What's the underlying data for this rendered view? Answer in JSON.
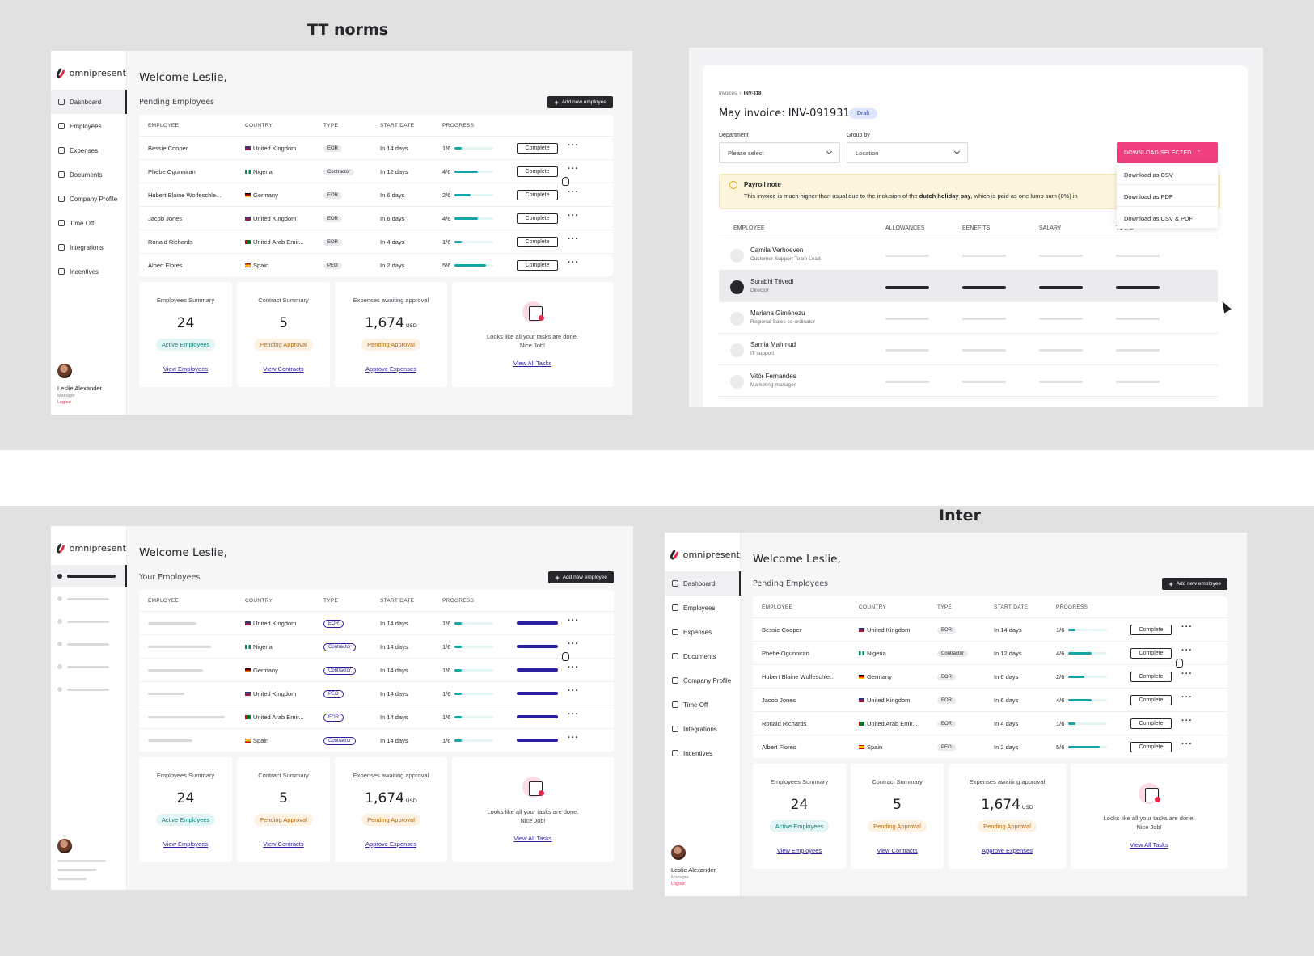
{
  "captions": {
    "tt_norms": "TT norms",
    "inter": "Inter"
  },
  "app": {
    "brand": "omnipresent",
    "welcome": "Welcome Leslie,",
    "pending_title": "Pending Employees",
    "your_employees_title": "Your Employees",
    "add_employee": "Add new employee",
    "nav": [
      "Dashboard",
      "Employees",
      "Expenses",
      "Documents",
      "Company Profile",
      "Time Off",
      "Integrations",
      "Incentives"
    ],
    "user": {
      "name": "Leslie Alexander",
      "role": "Manager",
      "logout": "Logout"
    },
    "columns": [
      "EMPLOYEE",
      "COUNTRY",
      "TYPE",
      "START DATE",
      "PROGRESS"
    ],
    "complete_label": "Complete",
    "rows": [
      {
        "name": "Bessie Cooper",
        "country": "United Kingdom",
        "type": "EOR",
        "start": "In 14 days",
        "progress": "1/6",
        "fill": 0.17
      },
      {
        "name": "Phebe Ogunniran",
        "country": "Nigeria",
        "type": "Contractor",
        "start": "In 12 days",
        "progress": "4/6",
        "fill": 0.6
      },
      {
        "name": "Hubert Blaine Wolfeschle...",
        "country": "Germany",
        "type": "EOR",
        "start": "In 6 days",
        "progress": "2/6",
        "fill": 0.4
      },
      {
        "name": "Jacob Jones",
        "country": "United Kingdom",
        "type": "EOR",
        "start": "In 6 days",
        "progress": "4/6",
        "fill": 0.6
      },
      {
        "name": "Ronald Richards",
        "country": "United Arab Emir...",
        "type": "EOR",
        "start": "In 4 days",
        "progress": "1/6",
        "fill": 0.17
      },
      {
        "name": "Albert Flores",
        "country": "Spain",
        "type": "PEO",
        "start": "In 2 days",
        "progress": "5/6",
        "fill": 0.8
      }
    ],
    "skeleton_rows": [
      {
        "country": "United Kingdom",
        "type": "EOR",
        "start": "In 14 days",
        "progress": "1/6",
        "fill": 0.17
      },
      {
        "country": "Nigeria",
        "type": "Contractor",
        "start": "In 14 days",
        "progress": "1/6",
        "fill": 0.17
      },
      {
        "country": "Germany",
        "type": "Contractor",
        "start": "In 14 days",
        "progress": "1/6",
        "fill": 0.17
      },
      {
        "country": "United Kingdom",
        "type": "PEO",
        "start": "In 14 days",
        "progress": "1/6",
        "fill": 0.17
      },
      {
        "country": "United Arab Emir...",
        "type": "EOR",
        "start": "In 14 days",
        "progress": "1/6",
        "fill": 0.17
      },
      {
        "country": "Spain",
        "type": "Contractor",
        "start": "In 14 days",
        "progress": "1/6",
        "fill": 0.17
      }
    ],
    "cards": {
      "employees": {
        "title": "Employees Summary",
        "value": "24",
        "badge": "Active Employees",
        "link": "View Employees"
      },
      "contracts": {
        "title": "Contract Summary",
        "value": "5",
        "badge": "Pending Approval",
        "link": "View Contracts"
      },
      "expenses": {
        "title": "Expenses awaiting approval",
        "value": "1,674",
        "unit": "USD",
        "badge": "Pending Approval",
        "link": "Approve Expenses"
      },
      "tasks": {
        "text1": "Looks like all your tasks are done.",
        "text2": "Nice Job!",
        "link": "View All Tasks"
      }
    }
  },
  "invoice": {
    "crumb_root": "Invoices",
    "crumb_current": "INV-318",
    "title": "May invoice: INV-091931",
    "status": "Draft",
    "department_label": "Department",
    "department_value": "Please select",
    "group_label": "Group by",
    "group_value": "Location",
    "download_btn": "DOWNLOAD SELECTED",
    "download_options": [
      "Download as CSV",
      "Download as PDF",
      "Download as CSV & PDF"
    ],
    "note_title": "Payroll note",
    "note_text_a": "This invoice is much higher than usual due to the inclusion of the ",
    "note_text_bold": "dutch holiday pay",
    "note_text_b": ", which is paid as one lump sum (8%) in",
    "columns": [
      "EMPLOYEE",
      "ALLOWANCES",
      "BENEFITS",
      "SALARY",
      "TOTAL"
    ],
    "employees": [
      {
        "name": "Camila Verhoeven",
        "role": "Customer Support Team Lead"
      },
      {
        "name": "Surabhi Trivedi",
        "role": "Director"
      },
      {
        "name": "Mariana Giménezu",
        "role": "Regional Sales co-ordinator"
      },
      {
        "name": "Samia Mahmud",
        "role": "IT support"
      },
      {
        "name": "Vitór Fernandes",
        "role": "Marketing manager"
      }
    ]
  },
  "colors": {
    "accent_pink": "#ef3f7e",
    "teal": "#14a6a6",
    "indigo": "#2a1fa3",
    "dark": "#26262b"
  }
}
